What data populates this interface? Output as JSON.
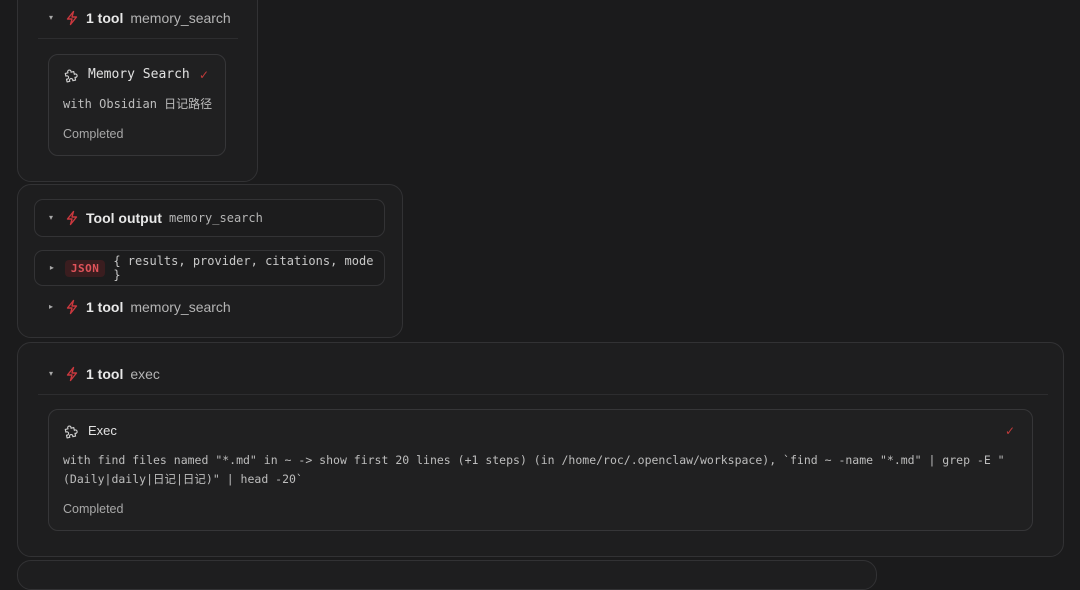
{
  "colors": {
    "background": "#1b1b1c",
    "accent_red": "#c9383e",
    "json_badge_bg": "#3a1d1f"
  },
  "group1": {
    "toolrow": {
      "count": "1 tool",
      "name": "memory_search"
    },
    "card": {
      "title": "Memory Search",
      "detail": "with Obsidian 日记路径",
      "status": "Completed",
      "check": "✓"
    }
  },
  "group2": {
    "output_row": {
      "label": "Tool output",
      "name": "memory_search"
    },
    "json_row": {
      "badge": "JSON",
      "summary": "{ results, provider, citations, mode }"
    },
    "toolrow": {
      "count": "1 tool",
      "name": "memory_search"
    }
  },
  "group3": {
    "toolrow": {
      "count": "1 tool",
      "name": "exec"
    },
    "card": {
      "title": "Exec",
      "detail_line1": "with find files named \"*.md\" in ~ -> show first 20 lines (+1 steps) (in /home/roc/.openclaw/workspace), `find ~ -name \"*.md\" | grep -E \"",
      "detail_line2": "(Daily|daily|日记|日记)\" | head -20`",
      "status": "Completed",
      "check": "✓"
    }
  },
  "icons": {
    "chevron_expanded": "▾",
    "chevron_collapsed": "▸",
    "bolt": "lightning-icon",
    "puzzle": "puzzle-icon"
  }
}
